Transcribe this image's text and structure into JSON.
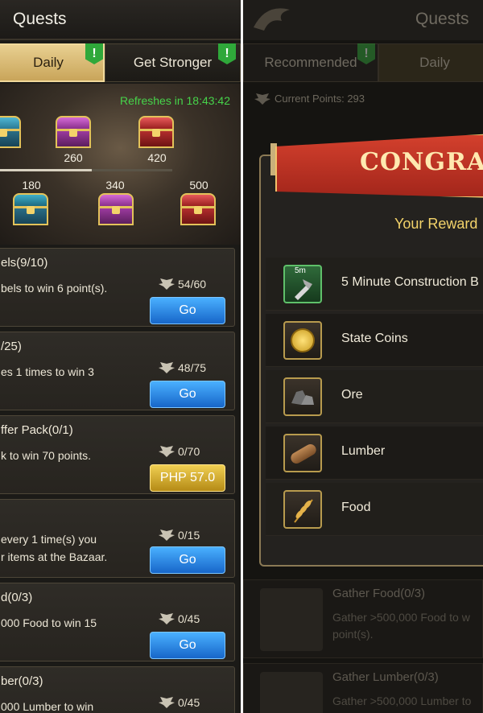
{
  "left": {
    "title": "Quests",
    "tabs": [
      {
        "label": "Daily",
        "badge": "!"
      },
      {
        "label": "Get Stronger",
        "badge": "!"
      }
    ],
    "refresh_text": "Refreshes in 18:43:42",
    "milestones_top": [
      "260",
      "420"
    ],
    "milestones_bottom": [
      "180",
      "340",
      "500"
    ],
    "quests": [
      {
        "title": "els(9/10)",
        "desc": [
          "bels to win 6 point(s)."
        ],
        "points": "54/60",
        "button": "Go",
        "type": "go"
      },
      {
        "title": "/25)",
        "desc": [
          "es 1 times to win 3"
        ],
        "points": "48/75",
        "button": "Go",
        "type": "go"
      },
      {
        "title": "ffer Pack(0/1)",
        "desc": [
          "k to win 70 points."
        ],
        "points": "0/70",
        "button": "PHP 57.0",
        "type": "pay"
      },
      {
        "title": "",
        "desc": [
          "every 1 time(s) you",
          "r items at the Bazaar."
        ],
        "points": "0/15",
        "button": "Go",
        "type": "go"
      },
      {
        "title": "d(0/3)",
        "desc": [
          "000 Food to win 15"
        ],
        "points": "0/45",
        "button": "Go",
        "type": "go"
      },
      {
        "title": "ber(0/3)",
        "desc": [
          "000 Lumber to win"
        ],
        "points": "0/45",
        "button": "",
        "type": "go"
      }
    ]
  },
  "right": {
    "title": "Quests",
    "tabs": [
      "Recommended",
      "Daily"
    ],
    "current_points": "Current Points: 293",
    "congrats": "CONGRA",
    "subtitle": "Your Reward",
    "rewards": [
      {
        "label": "5 Minute Construction B",
        "icon": "construction-speedup-icon",
        "icon_text": "5m"
      },
      {
        "label": "State Coins",
        "icon": "state-coin-icon"
      },
      {
        "label": "Ore",
        "icon": "ore-icon"
      },
      {
        "label": "Lumber",
        "icon": "lumber-icon"
      },
      {
        "label": "Food",
        "icon": "food-icon"
      }
    ],
    "bg_quests": [
      {
        "title": "Gather Food(0/3)",
        "desc": [
          "Gather >500,000 Food to w",
          "point(s)."
        ]
      },
      {
        "title": "Gather Lumber(0/3)",
        "desc": [
          "Gather >500,000 Lumber to"
        ]
      }
    ]
  },
  "colors": {
    "accent_green": "#46d34a",
    "go_blue": "#1f7fe0",
    "pay_gold": "#d4ad2a",
    "ribbon_red": "#c2311f"
  }
}
